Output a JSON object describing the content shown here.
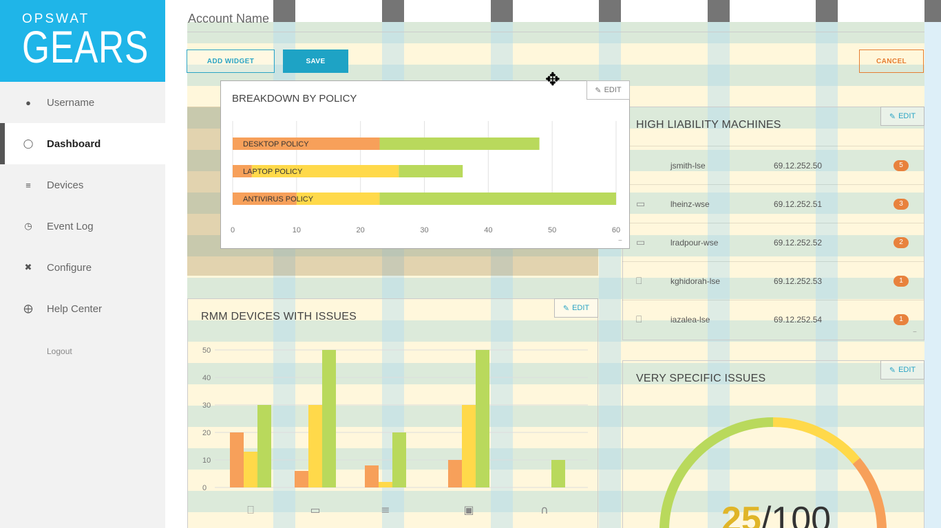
{
  "sidebar": {
    "brand_top": "OPSWAT",
    "brand_main": "GEARS",
    "items": [
      {
        "label": "Username",
        "icon": "user-icon"
      },
      {
        "label": "Dashboard",
        "icon": "gauge-icon",
        "active": true
      },
      {
        "label": "Devices",
        "icon": "list-icon"
      },
      {
        "label": "Event Log",
        "icon": "clock-icon"
      },
      {
        "label": "Configure",
        "icon": "tools-icon"
      },
      {
        "label": "Help Center",
        "icon": "lifebuoy-icon"
      }
    ],
    "logout": "Logout"
  },
  "header": {
    "account_name": "Account Name",
    "add_widget": "ADD WIDGET",
    "save": "SAVE",
    "cancel": "CANCEL"
  },
  "colors": {
    "brand": "#1fb5e8",
    "accent": "#1ea3c5",
    "cancel": "#e57d32",
    "orange": "#f7a05a",
    "yellow": "#ffd94a",
    "green": "#b9d95c"
  },
  "breakdown": {
    "title": "BREAKDOWN BY POLICY",
    "edit": "EDIT",
    "chart_data": {
      "type": "bar",
      "orientation": "horizontal",
      "stacked": true,
      "categories": [
        "DESKTOP POLICY",
        "LAPTOP POLICY",
        "ANTIVIRUS POLICY"
      ],
      "series": [
        {
          "color": "#f7a05a",
          "values": [
            23,
            3,
            10
          ]
        },
        {
          "color": "#ffd94a",
          "values": [
            0,
            23,
            13
          ]
        },
        {
          "color": "#b9d95c",
          "values": [
            25,
            10,
            37
          ]
        }
      ],
      "xlim": [
        0,
        60
      ],
      "xticks": [
        "0",
        "10",
        "20",
        "30",
        "40",
        "50",
        "60"
      ]
    }
  },
  "high_liability": {
    "title": "HIGH LIABILITY MACHINES",
    "edit": "EDIT",
    "rows": [
      {
        "host": "jsmith-lse",
        "ip": "69.12.252.50",
        "count": "5",
        "icon": "none"
      },
      {
        "host": "lheinz-wse",
        "ip": "69.12.252.51",
        "count": "3",
        "icon": "monitor-icon"
      },
      {
        "host": "lradpour-wse",
        "ip": "69.12.252.52",
        "count": "2",
        "icon": "monitor-icon"
      },
      {
        "host": "kghidorah-lse",
        "ip": "69.12.252.53",
        "count": "1",
        "icon": "laptop-icon"
      },
      {
        "host": "iazalea-lse",
        "ip": "69.12.252.54",
        "count": "1",
        "icon": "laptop-icon"
      }
    ]
  },
  "rmm": {
    "title": "RMM DEVICES WITH ISSUES",
    "edit": "EDIT",
    "chart_data": {
      "type": "bar",
      "categories": [
        "laptop",
        "desktop",
        "server",
        "vm",
        "ghost"
      ],
      "category_icons": [
        "laptop-icon",
        "monitor-icon",
        "server-icon",
        "vm-icon",
        "ghost-icon"
      ],
      "series": [
        {
          "color": "#f7a05a",
          "values": [
            20,
            6,
            8,
            10,
            0
          ]
        },
        {
          "color": "#ffd94a",
          "values": [
            13,
            30,
            2,
            30,
            0
          ]
        },
        {
          "color": "#b9d95c",
          "values": [
            30,
            50,
            20,
            50,
            10
          ]
        }
      ],
      "ylim": [
        0,
        50
      ],
      "yticks": [
        "0",
        "10",
        "20",
        "30",
        "40",
        "50"
      ]
    }
  },
  "specific": {
    "title": "VERY SPECIFIC ISSUES",
    "edit": "EDIT",
    "score": "25",
    "total": "/100",
    "gauge_value": 25,
    "gauge_max": 100
  }
}
